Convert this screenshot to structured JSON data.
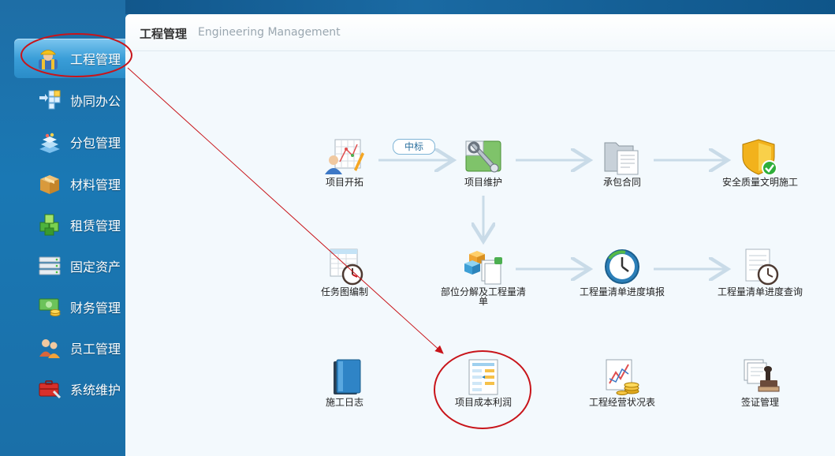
{
  "sidebar": {
    "items": [
      {
        "label": "工程管理",
        "icon": "worker-icon",
        "active": true
      },
      {
        "label": "协同办公",
        "icon": "collaboration-icon",
        "active": false
      },
      {
        "label": "分包管理",
        "icon": "subcontract-icon",
        "active": false
      },
      {
        "label": "材料管理",
        "icon": "box-icon",
        "active": false
      },
      {
        "label": "租赁管理",
        "icon": "cubes-icon",
        "active": false
      },
      {
        "label": "固定资产",
        "icon": "server-rack-icon",
        "active": false
      },
      {
        "label": "财务管理",
        "icon": "money-icon",
        "active": false
      },
      {
        "label": "员工管理",
        "icon": "users-icon",
        "active": false
      },
      {
        "label": "系统维护",
        "icon": "toolbox-icon",
        "active": false
      }
    ]
  },
  "header": {
    "title_cn": "工程管理",
    "title_en": "Engineering Management"
  },
  "flow": {
    "badge": "中标",
    "modules": {
      "project_start": {
        "label": "项目开拓",
        "icon": "project-start-icon"
      },
      "project_maint": {
        "label": "项目维护",
        "icon": "project-maintenance-icon"
      },
      "contract": {
        "label": "承包合同",
        "icon": "contract-folder-icon"
      },
      "safety": {
        "label": "安全质量文明施工",
        "icon": "safety-shield-icon"
      },
      "task_chart": {
        "label": "任务图编制",
        "icon": "task-chart-icon"
      },
      "decompose": {
        "label": "部位分解及工程量清单",
        "icon": "decompose-icon"
      },
      "progress_fill": {
        "label": "工程量清单进度填报",
        "icon": "progress-clock-icon"
      },
      "progress_query": {
        "label": "工程量清单进度查询",
        "icon": "progress-query-icon"
      },
      "daily_log": {
        "label": "施工日志",
        "icon": "logbook-icon"
      },
      "cost_profit": {
        "label": "项目成本利润",
        "icon": "cost-profit-icon"
      },
      "status_report": {
        "label": "工程经营状况表",
        "icon": "status-report-icon"
      },
      "visa": {
        "label": "签证管理",
        "icon": "visa-stamp-icon"
      }
    }
  },
  "colors": {
    "annotation_red": "#c8141a",
    "accent": "#2a8cc8"
  }
}
